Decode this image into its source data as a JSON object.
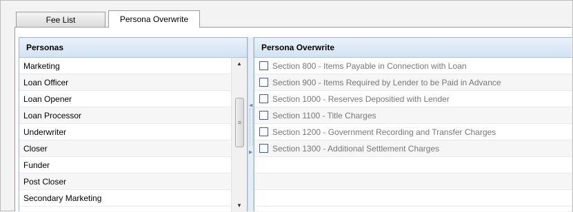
{
  "tabs": [
    {
      "label": "Fee List",
      "active": false
    },
    {
      "label": "Persona Overwrite",
      "active": true
    }
  ],
  "personas": {
    "header": "Personas",
    "items": [
      "Marketing",
      "Loan Officer",
      "Loan Opener",
      "Loan Processor",
      "Underwriter",
      "Closer",
      "Funder",
      "Post Closer",
      "Secondary Marketing"
    ],
    "scroll": {
      "up_icon": "scroll-up-arrow",
      "down_icon": "scroll-down-arrow"
    }
  },
  "overwrite": {
    "header": "Persona Overwrite",
    "items": [
      {
        "label": "Section 800 - Items Payable in Connection with Loan",
        "checked": false
      },
      {
        "label": "Section 900 - Items Required by Lender to be Paid in Advance",
        "checked": false
      },
      {
        "label": "Section 1000 - Reserves Depositied with Lender",
        "checked": false
      },
      {
        "label": "Section 1100 - Title Charges",
        "checked": false
      },
      {
        "label": "Section 1200 - Government Recording and Transfer Charges",
        "checked": false
      },
      {
        "label": "Section 1300 - Additional Settlement Charges",
        "checked": false
      }
    ]
  },
  "colors": {
    "checkbox_border": "#3e5a99",
    "header_bg": "#dce8f5",
    "disabled_text": "#777777"
  }
}
